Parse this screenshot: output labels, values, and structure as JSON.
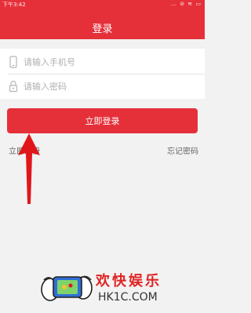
{
  "status_bar": {
    "time": "下午3:42",
    "icons": "… ⊘ ≋ ▭"
  },
  "header": {
    "title": "登录"
  },
  "form": {
    "phone_placeholder": "请输入手机号",
    "password_placeholder": "请输入密码",
    "login_label": "立即登录",
    "register_label": "立即注册",
    "forgot_label": "忘记密码"
  },
  "watermark": {
    "text_cn": "欢快娱乐",
    "text_en": "HK1C.COM"
  },
  "colors": {
    "brand_red": "#e5303a",
    "background": "#f2f2f2"
  },
  "icons": [
    "phone-icon",
    "lock-icon",
    "arrow-annotation-icon",
    "game-controller-icon"
  ]
}
